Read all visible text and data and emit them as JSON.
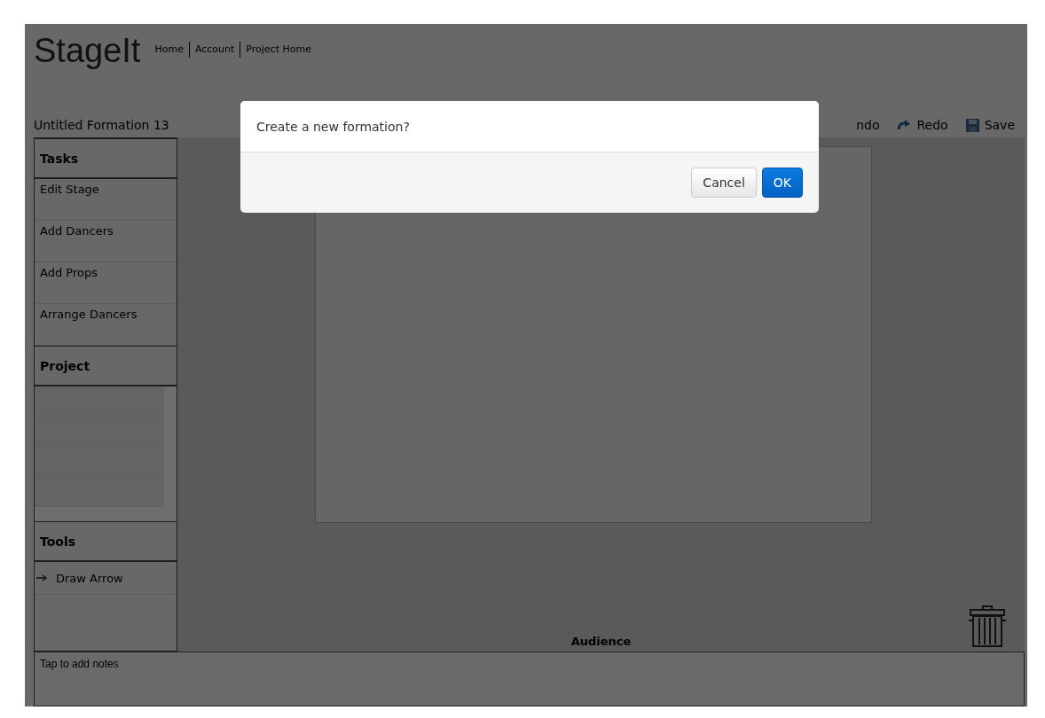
{
  "header": {
    "brand": "StageIt",
    "nav": [
      "Home",
      "Account",
      "Project Home"
    ]
  },
  "formation_title": "Untitled Formation 13",
  "toolbar": [
    {
      "kind": "undo",
      "label": "ndo"
    },
    {
      "kind": "redo",
      "label": "Redo"
    },
    {
      "kind": "save",
      "label": "Save"
    }
  ],
  "tasks": {
    "title": "Tasks",
    "items": [
      "Edit Stage",
      "Add Dancers",
      "Add Props",
      "Arrange Dancers"
    ]
  },
  "project": {
    "title": "Project"
  },
  "tools": {
    "title": "Tools",
    "items": [
      "Draw Arrow"
    ]
  },
  "audience_label": "Audience",
  "notes": {
    "placeholder": "Tap to add notes"
  },
  "dialog": {
    "message": "Create a new formation?",
    "buttons": [
      {
        "kind": "secondary",
        "label": "Cancel"
      },
      {
        "kind": "primary",
        "label": "OK"
      }
    ]
  }
}
